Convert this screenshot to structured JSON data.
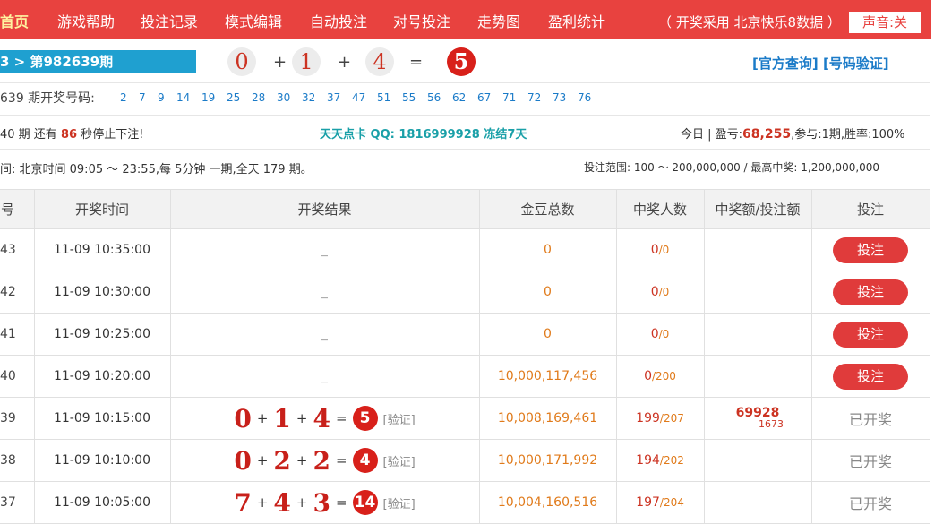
{
  "nav": {
    "items": [
      "首页",
      "游戏帮助",
      "投注记录",
      "模式编辑",
      "自动投注",
      "对号投注",
      "走势图",
      "盈利统计"
    ],
    "source_text": "（ 开奖采用 北京快乐8数据 ）",
    "sound_label": "声音:关"
  },
  "current": {
    "period_label": "3 > 第982639期",
    "digits": [
      "0",
      "1",
      "4"
    ],
    "plus": "+",
    "equals": "=",
    "sum": "5",
    "official_link": "[官方查询]",
    "verify_link": "[号码验证]"
  },
  "draw": {
    "label": "639 期开奖号码:",
    "numbers": [
      "2",
      "7",
      "9",
      "14",
      "19",
      "25",
      "28",
      "30",
      "32",
      "37",
      "47",
      "51",
      "55",
      "56",
      "62",
      "67",
      "71",
      "72",
      "73",
      "76"
    ]
  },
  "status": {
    "period_prefix": "40 期 还有",
    "countdown": "86",
    "period_suffix": "秒停止下注!",
    "promo": "天天点卡 QQ: 1816999928 冻结7天",
    "today_label": "今日 | 盈亏:",
    "today_pnl": "68,255",
    "today_rest": ",参与:1期,胜率:100%"
  },
  "schedule": {
    "left": "间: 北京时间 09:05 ～ 23:55,每 5分钟 一期,全天 179 期。",
    "right": "投注范围: 100 ～ 200,000,000 / 最高中奖: 1,200,000,000"
  },
  "table": {
    "headers": [
      "号",
      "开奖时间",
      "开奖结果",
      "金豆总数",
      "中奖人数",
      "中奖额/投注额",
      "投注"
    ],
    "rows": [
      {
        "issue": "43",
        "time": "11-09 10:35:00",
        "pending": "_",
        "gold": "0",
        "winners": "0",
        "total": "0",
        "bet": "投注"
      },
      {
        "issue": "42",
        "time": "11-09 10:30:00",
        "pending": "_",
        "gold": "0",
        "winners": "0",
        "total": "0",
        "bet": "投注"
      },
      {
        "issue": "41",
        "time": "11-09 10:25:00",
        "pending": "_",
        "gold": "0",
        "winners": "0",
        "total": "0",
        "bet": "投注"
      },
      {
        "issue": "40",
        "time": "11-09 10:20:00",
        "pending": "_",
        "gold": "10,000,117,456",
        "winners": "0",
        "total": "200",
        "bet": "投注"
      },
      {
        "issue": "39",
        "time": "11-09 10:15:00",
        "digits": [
          "0",
          "1",
          "4"
        ],
        "sum": "5",
        "verify": "[验证]",
        "gold": "10,008,169,461",
        "winners": "199",
        "total": "207",
        "amount": "69928",
        "amount_sub": "1673",
        "status": "已开奖"
      },
      {
        "issue": "38",
        "time": "11-09 10:10:00",
        "digits": [
          "0",
          "2",
          "2"
        ],
        "sum": "4",
        "verify": "[验证]",
        "gold": "10,000,171,992",
        "winners": "194",
        "total": "202",
        "status": "已开奖"
      },
      {
        "issue": "37",
        "time": "11-09 10:05:00",
        "digits": [
          "7",
          "4",
          "3"
        ],
        "sum": "14",
        "verify": "[验证]",
        "gold": "10,004,160,516",
        "winners": "197",
        "total": "204",
        "status": "已开奖"
      }
    ]
  },
  "colors": {
    "nav_bg": "#e8423f",
    "accent_red": "#d8201a",
    "link_blue": "#1b7bc8",
    "gold_orange": "#e07a1a",
    "period_bar": "#1fa0d0"
  }
}
